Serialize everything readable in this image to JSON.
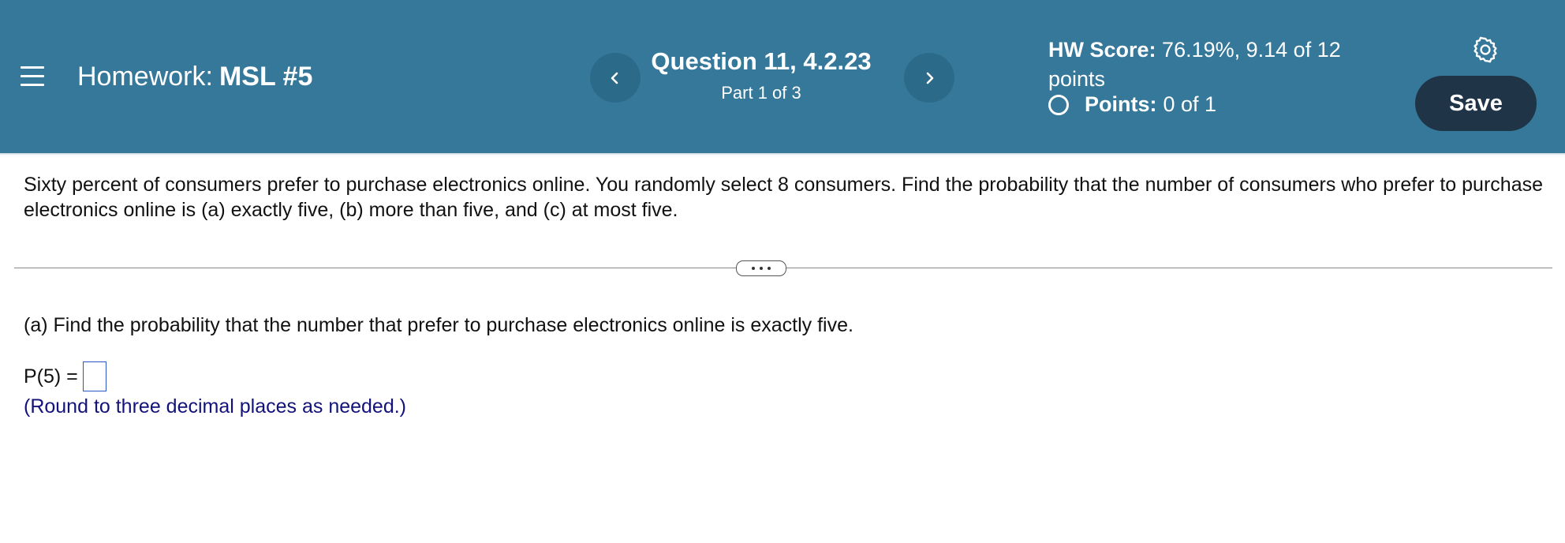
{
  "header": {
    "homework_label": "Homework:",
    "homework_name": "MSL #5",
    "question_title": "Question 11, 4.2.23",
    "question_part": "Part 1 of 3",
    "hw_score_label": "HW Score:",
    "hw_score_value": "76.19%, 9.14 of 12 points",
    "points_label": "Points:",
    "points_value": "0 of 1",
    "save_label": "Save"
  },
  "icons": {
    "menu": "menu-icon",
    "prev": "chevron-left-icon",
    "next": "chevron-right-icon",
    "settings": "gear-icon",
    "points_status": "circle-icon"
  },
  "colors": {
    "header_bg": "#35789a",
    "nav_button_bg": "#2c6a89",
    "save_button_bg": "#1f3447",
    "input_border": "#2a56c6",
    "hint_text": "#12127a"
  },
  "question": {
    "text": "Sixty percent of consumers prefer to purchase electronics online. You randomly select 8 consumers. Find the probability that the number of consumers who prefer to purchase electronics online is (a) exactly five, (b) more than five, and (c) at most five.",
    "part_a": "(a) Find the probability that the number that prefer to purchase electronics online is exactly five.",
    "answer_label": "P(5) =",
    "answer_value": "",
    "hint": "(Round to three decimal places as needed.)"
  }
}
